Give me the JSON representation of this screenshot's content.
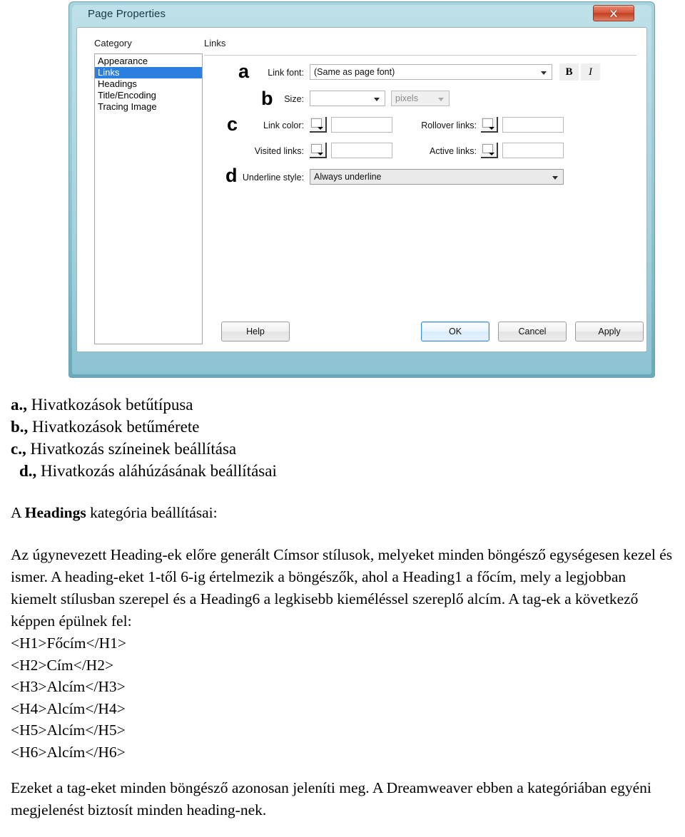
{
  "dialog": {
    "title": "Page Properties",
    "close_button_label": "X",
    "category_label": "Category",
    "panel_label": "Links",
    "categories": [
      {
        "label": "Appearance",
        "selected": false
      },
      {
        "label": "Links",
        "selected": true
      },
      {
        "label": "Headings",
        "selected": false
      },
      {
        "label": "Title/Encoding",
        "selected": false
      },
      {
        "label": "Tracing Image",
        "selected": false
      }
    ],
    "annotations": {
      "a": "a",
      "b": "b",
      "c": "c",
      "d": "d"
    },
    "fields": {
      "link_font_label": "Link font:",
      "link_font_value": "(Same as page font)",
      "bold_label": "B",
      "italic_label": "I",
      "size_label": "Size:",
      "size_value": "",
      "size_unit_value": "pixels",
      "link_color_label": "Link color:",
      "link_color_value": "",
      "rollover_links_label": "Rollover links:",
      "rollover_links_value": "",
      "visited_links_label": "Visited links:",
      "visited_links_value": "",
      "active_links_label": "Active links:",
      "active_links_value": "",
      "underline_style_label": "Underline style:",
      "underline_style_value": "Always underline"
    },
    "buttons": {
      "help": "Help",
      "ok": "OK",
      "cancel": "Cancel",
      "apply": "Apply"
    }
  },
  "document": {
    "legend": [
      {
        "marker": "a.,",
        "text": "Hivatkozások betűtípusa"
      },
      {
        "marker": "b.,",
        "text": "Hivatkozások betűmérete"
      },
      {
        "marker": "c.,",
        "text": "Hivatkozás színeinek beállítása"
      },
      {
        "marker": "d.,",
        "text": "Hivatkozás aláhúzásának beállításai"
      }
    ],
    "heading_intro_prefix": "A ",
    "heading_intro_bold": "Headings",
    "heading_intro_suffix": " kategória beállításai:",
    "paragraph1": "Az úgynevezett Heading-ek előre generált Címsor stílusok, melyeket minden böngésző egységesen kezel és ismer. A heading-eket 1-től 6-ig értelmezik a böngészők, ahol a Heading1 a főcím, mely a legjobban kiemelt stílusban szerepel és a Heading6 a legkisebb kieméléssel szereplő alcím. A tag-ek a következő képpen épülnek fel:",
    "tags": [
      "<H1>Főcím</H1>",
      "<H2>Cím</H2>",
      "<H3>Alcím</H3>",
      "<H4>Alcím</H4>",
      "<H5>Alcím</H5>",
      "<H6>Alcím</H6>"
    ],
    "paragraph2": "Ezeket a tag-eket minden böngésző azonosan jeleníti meg. A Dreamweaver ebben a kategóriában egyéni megjelenést biztosít minden heading-nek."
  }
}
